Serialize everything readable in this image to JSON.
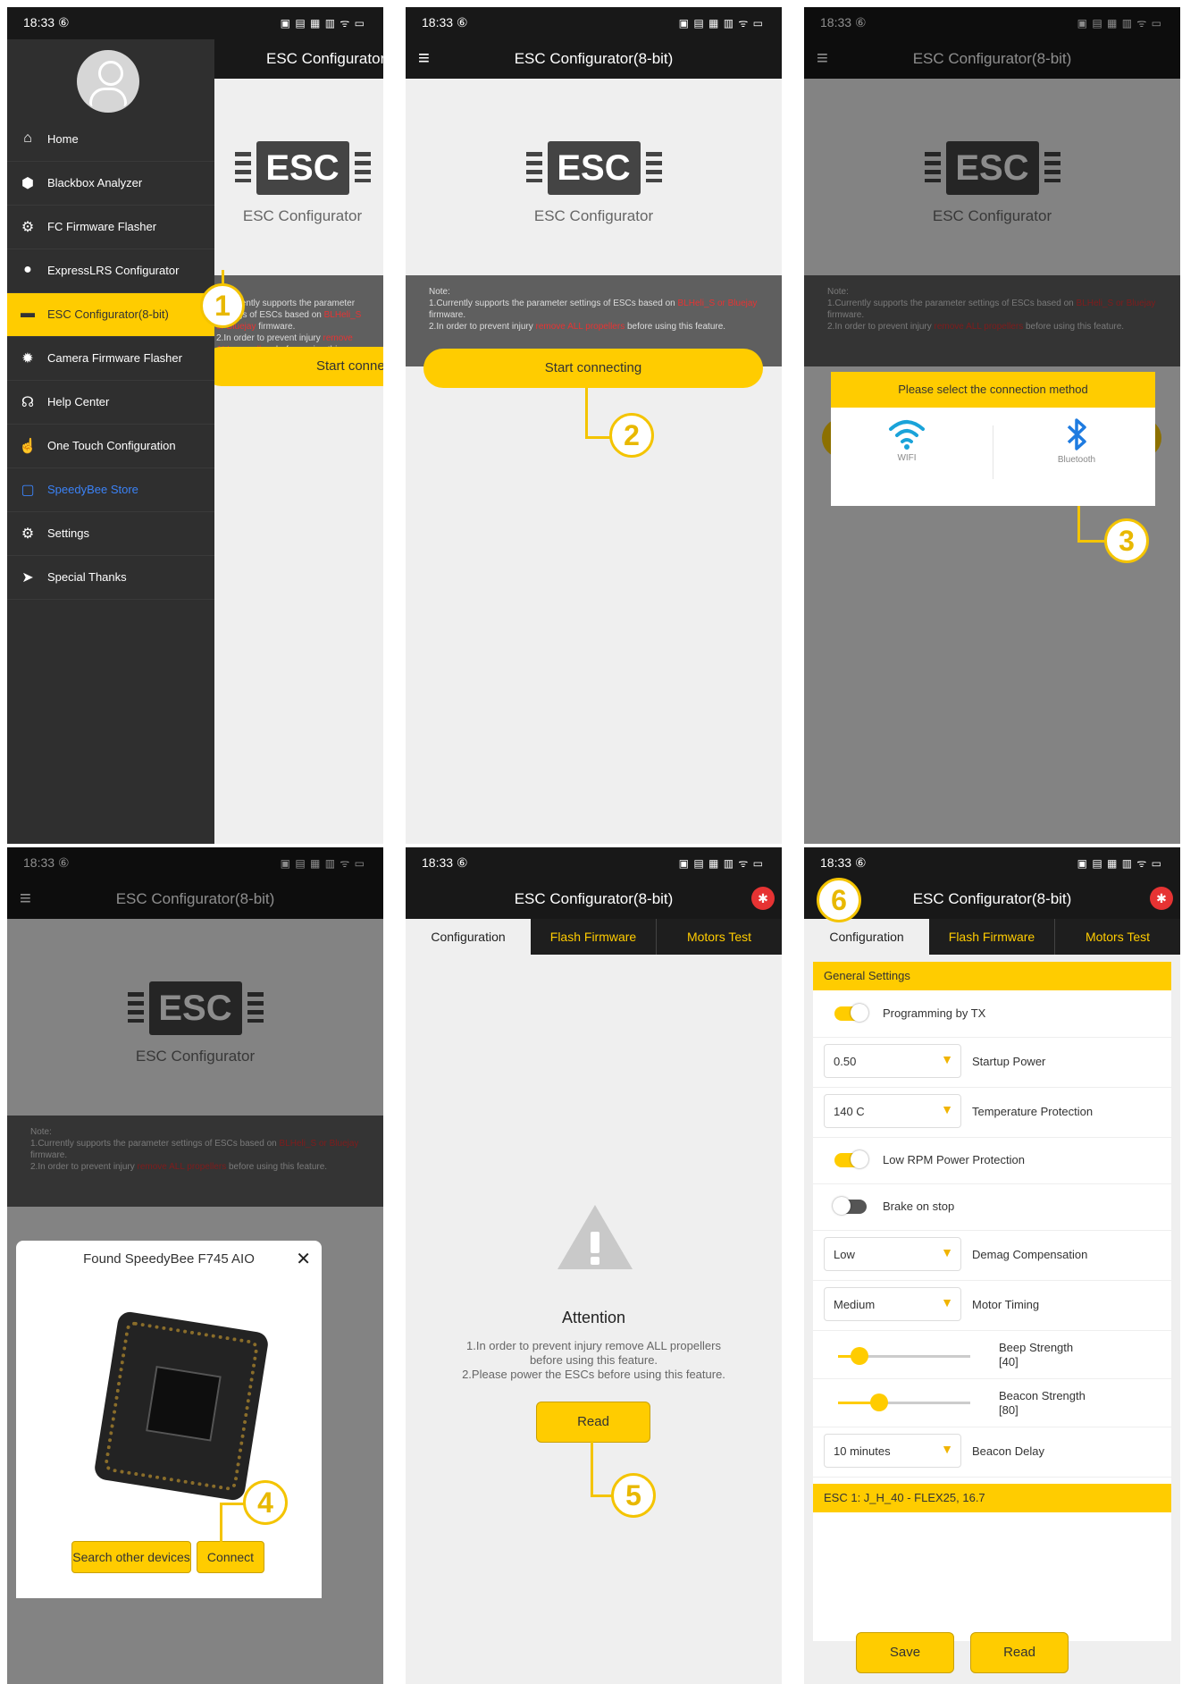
{
  "status": {
    "time": "18:33",
    "indicator": "⑥",
    "icons": "▣ ▤ ▦ ▥ ᯤ ▭"
  },
  "app_title": "ESC Configurator(8-bit)",
  "drawer": {
    "items": [
      {
        "icon": "home-icon",
        "glyph": "⌂",
        "label": "Home"
      },
      {
        "icon": "cube-icon",
        "glyph": "⬢",
        "label": "Blackbox Analyzer"
      },
      {
        "icon": "chip-icon",
        "glyph": "⚙",
        "label": "FC Firmware Flasher"
      },
      {
        "icon": "globe-icon",
        "glyph": "●",
        "label": "ExpressLRS Configurator"
      },
      {
        "icon": "esc-icon",
        "glyph": "▬",
        "label": "ESC Configurator(8-bit)"
      },
      {
        "icon": "camera-chip-icon",
        "glyph": "✹",
        "label": "Camera Firmware Flasher"
      },
      {
        "icon": "help-icon",
        "glyph": "☊",
        "label": "Help Center"
      },
      {
        "icon": "touch-icon",
        "glyph": "☝",
        "label": "One Touch Configuration"
      },
      {
        "icon": "bag-icon",
        "glyph": "▢",
        "label": "SpeedyBee Store"
      },
      {
        "icon": "gear-icon",
        "glyph": "⚙",
        "label": "Settings"
      },
      {
        "icon": "thanks-icon",
        "glyph": "➤",
        "label": "Special Thanks"
      }
    ]
  },
  "logo": {
    "chip_text": "ESC",
    "sub": "ESC Configurator"
  },
  "note": {
    "heading": "Note:",
    "line1_a": "1.Currently supports the parameter settings of ESCs based on",
    "line1_red": "BLHeli_S or Bluejay",
    "line1_b": "firmware.",
    "line2_a": "2.In order to prevent injury",
    "line2_red": "remove ALL propellers",
    "line2_b": "before using this feature."
  },
  "start_button": "Start connecting",
  "connection_dialog": {
    "title": "Please select the connection method",
    "wifi": "WIFI",
    "bluetooth": "Bluetooth"
  },
  "found_dialog": {
    "title": "Found SpeedyBee F745 AIO",
    "close": "✕",
    "search_button": "Search other devices",
    "connect_button": "Connect"
  },
  "tabs": [
    "Configuration",
    "Flash Firmware",
    "Motors Test"
  ],
  "attention": {
    "title": "Attention",
    "line1": "1.In order to prevent injury remove ALL propellers",
    "line2": "before using this feature.",
    "line3": "2.Please power the ESCs before using this feature.",
    "read_button": "Read"
  },
  "settings": {
    "section": "General Settings",
    "programming_by_tx": "Programming by TX",
    "startup_power_value": "0.50",
    "startup_power_label": "Startup Power",
    "temp_value": "140 C",
    "temp_label": "Temperature Protection",
    "low_rpm": "Low RPM Power Protection",
    "brake": "Brake on stop",
    "demag_value": "Low",
    "demag_label": "Demag Compensation",
    "timing_value": "Medium",
    "timing_label": "Motor Timing",
    "beep_label": "Beep Strength",
    "beep_value": "[40]",
    "beep_level": 0.16,
    "beacon_label": "Beacon Strength",
    "beacon_value": "[80]",
    "beacon_level": 0.31,
    "delay_value": "10 minutes",
    "delay_label": "Beacon Delay",
    "esc_header": "ESC 1: J_H_40 - FLEX25, 16.7",
    "save_button": "Save",
    "read_button": "Read"
  },
  "steps": [
    "1",
    "2",
    "3",
    "4",
    "5",
    "6"
  ],
  "colors": {
    "accent": "#ffcc00",
    "danger": "#e63333",
    "bar": "#181818",
    "bluetooth": "#1e7be0",
    "wifi": "#1aa3d9"
  }
}
